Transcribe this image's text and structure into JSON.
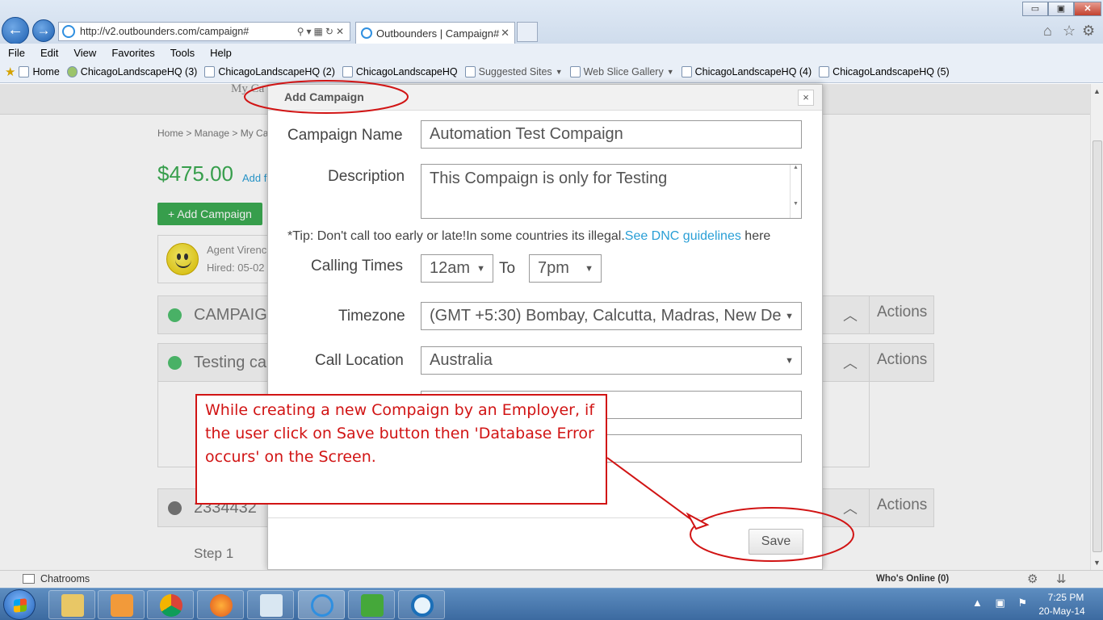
{
  "browser": {
    "url": "http://v2.outbounders.com/campaign#",
    "tab_title": "Outbounders | Campaign#",
    "window_controls": {
      "minimize": "▭",
      "maximize": "▣",
      "close": "✕"
    },
    "menu": [
      "File",
      "Edit",
      "View",
      "Favorites",
      "Tools",
      "Help"
    ],
    "favorites": [
      {
        "label": "Home",
        "dim": false,
        "dropdown": false
      },
      {
        "label": "ChicagoLandscapeHQ (3)",
        "dim": false,
        "dropdown": false
      },
      {
        "label": "ChicagoLandscapeHQ (2)",
        "dim": false,
        "dropdown": false
      },
      {
        "label": "ChicagoLandscapeHQ",
        "dim": false,
        "dropdown": false
      },
      {
        "label": "Suggested Sites",
        "dim": true,
        "dropdown": true
      },
      {
        "label": "Web Slice Gallery",
        "dim": true,
        "dropdown": true
      },
      {
        "label": "ChicagoLandscapeHQ (4)",
        "dim": false,
        "dropdown": false
      },
      {
        "label": "ChicagoLandscapeHQ (5)",
        "dim": false,
        "dropdown": false
      }
    ]
  },
  "page": {
    "my_campaigns_partial": "My Ca",
    "breadcrumb": "Home > Manage > My Ca",
    "balance": "$475.00",
    "add_funds_partial": "Add f",
    "add_campaign_button": "+ Add Campaign",
    "agent": {
      "name": "Agent Virenc",
      "hired": "Hired: 05-02"
    },
    "campaigns": [
      {
        "name": "CAMPAIG",
        "status_color": "#4fbf6e",
        "actions": "Actions"
      },
      {
        "name": "Testing ca",
        "status_color": "#4fbf6e",
        "actions": "Actions"
      },
      {
        "name": "2334432",
        "status_color": "#777777",
        "actions": "Actions"
      }
    ],
    "step": "Step 1"
  },
  "modal": {
    "title": "Add Campaign",
    "close": "×",
    "campaign_name_label": "Campaign Name",
    "campaign_name_value": "Automation Test Compaign",
    "description_label": "Description",
    "description_value": "This Compaign is only for Testing",
    "tip_text": "*Tip: Don't call too early or late!In some countries its illegal.",
    "tip_link": "See DNC guidelines",
    "tip_suffix": " here",
    "calling_times_label": "Calling Times",
    "calling_from": "12am",
    "to_label": "To",
    "calling_to": "7pm",
    "timezone_label": "Timezone",
    "timezone_value": "(GMT +5:30) Bombay, Calcutta, Madras, New De",
    "call_location_label": "Call Location",
    "call_location_value": "Australia",
    "save_button": "Save"
  },
  "annotation": {
    "text": "While creating a new Compaign by an Employer, if the user click on Save button then 'Database Error occurs' on the Screen.",
    "color": "#d11414"
  },
  "statusbar": {
    "chatrooms": "Chatrooms",
    "whos_online": "Who's Online (0)"
  },
  "taskbar": {
    "time": "7:25 PM",
    "date": "20-May-14"
  }
}
